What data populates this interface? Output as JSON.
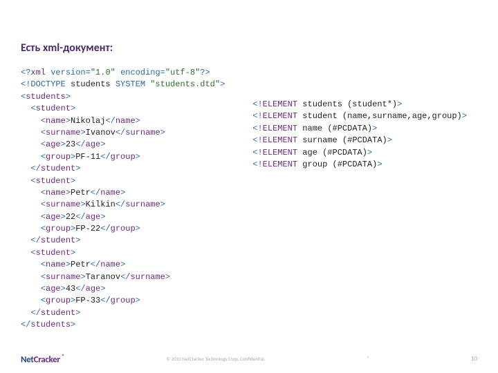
{
  "title": "Есть xml-документ:",
  "xml_prolog": {
    "open": "<?",
    "name": "xml",
    "att1": "version",
    "val1": "\"1.0\"",
    "att2": "encoding",
    "val2": "\"utf-8\"",
    "close": "?>"
  },
  "doctype": {
    "open": "<!DOCTYPE ",
    "root": "students",
    "sys": " SYSTEM ",
    "file": "\"students.dtd\"",
    "close": ">"
  },
  "xml": {
    "students": [
      {
        "name": "Nikolaj",
        "surname": "Ivanov",
        "age": "23",
        "group": "PF-11"
      },
      {
        "name": "Petr",
        "surname": "Kilkin",
        "age": "22",
        "group": "FP-22"
      },
      {
        "name": "Petr",
        "surname": "Taranov",
        "age": "43",
        "group": "FP-33"
      }
    ]
  },
  "tags": {
    "students": "students",
    "student": "student",
    "name": "name",
    "surname": "surname",
    "age": "age",
    "group": "group"
  },
  "dtd": [
    {
      "elem": "students",
      "content": "(student*)"
    },
    {
      "elem": "student",
      "content": "(name,surname,age,group)"
    },
    {
      "elem": "name",
      "content": "(#PCDATA)"
    },
    {
      "elem": "surname",
      "content": "(#PCDATA)"
    },
    {
      "elem": "age",
      "content": "(#PCDATA)"
    },
    {
      "elem": "group",
      "content": "(#PCDATA)"
    }
  ],
  "footer": {
    "logo_net": "Net",
    "logo_cracker": "Cracker",
    "reg": "®",
    "copyright": "© 2010 NetCracker Technology Corp. Confidential.",
    "star": "*",
    "page": "10"
  }
}
